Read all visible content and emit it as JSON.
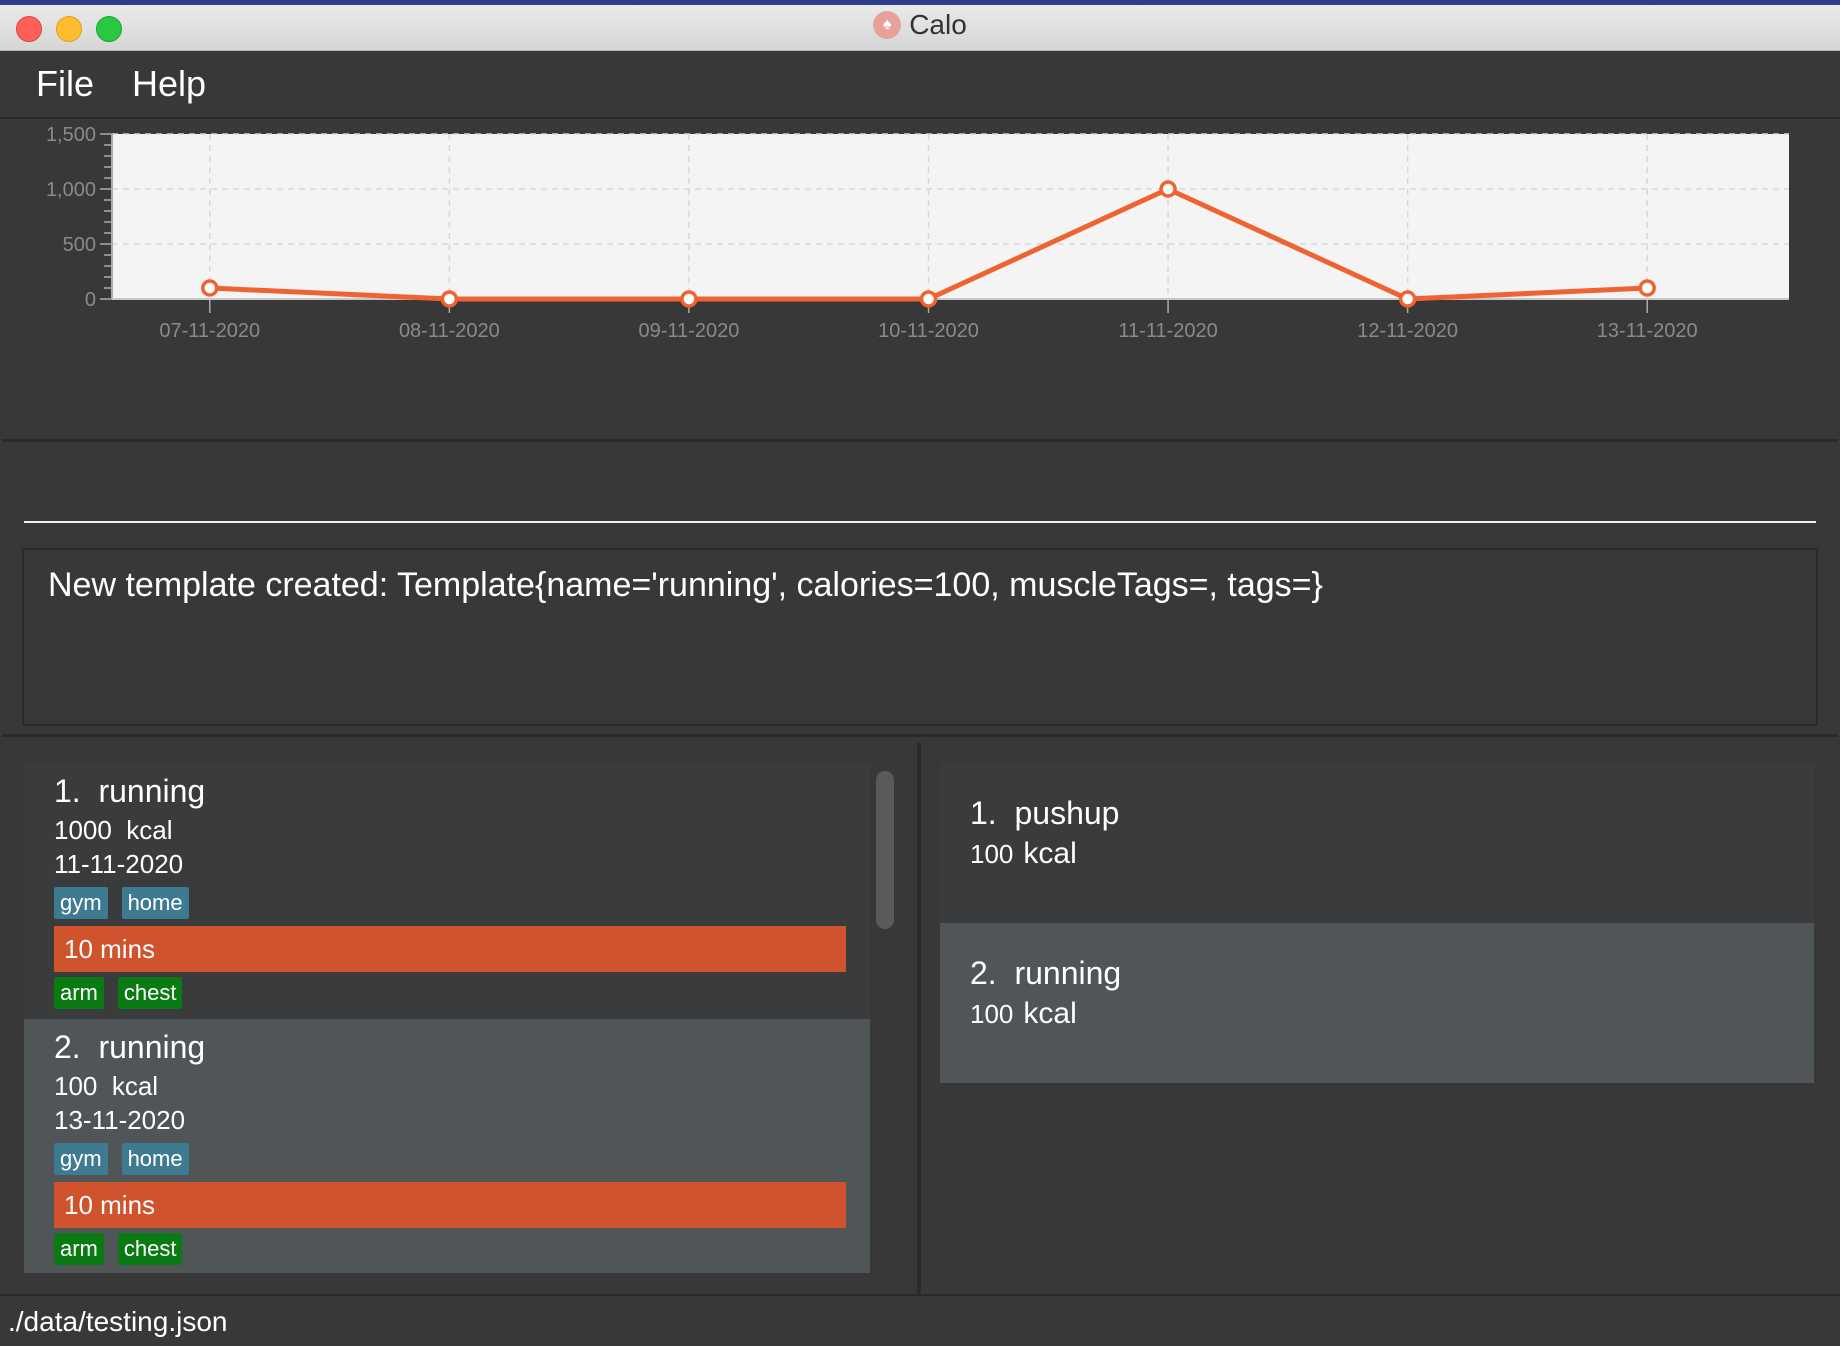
{
  "window": {
    "title": "Calo"
  },
  "menu": {
    "file": "File",
    "help": "Help"
  },
  "chart_data": {
    "type": "line",
    "x": [
      "07-11-2020",
      "08-11-2020",
      "09-11-2020",
      "10-11-2020",
      "11-11-2020",
      "12-11-2020",
      "13-11-2020"
    ],
    "series": [
      {
        "values": [
          100,
          0,
          0,
          0,
          1000,
          0,
          100
        ]
      }
    ],
    "y_ticks": [
      0,
      500,
      1000,
      1500
    ],
    "y_tick_labels": [
      "0",
      "500",
      "1,000",
      "1,500"
    ],
    "ylim": [
      0,
      1500
    ],
    "grid": true,
    "colors": {
      "line": "#ee6332",
      "plot_bg": "#f4f4f4"
    }
  },
  "command": {
    "value": ""
  },
  "result": {
    "text": "New template created: Template{name='running', calories=100, muscleTags=, tags=}"
  },
  "exercises": [
    {
      "index": "1.",
      "name": "running",
      "kcal_num": "1000",
      "kcal_unit": "kcal",
      "date": "11-11-2020",
      "tags": [
        "gym",
        "home"
      ],
      "duration": "10 mins",
      "muscles": [
        "arm",
        "chest"
      ]
    },
    {
      "index": "2.",
      "name": "running",
      "kcal_num": "100",
      "kcal_unit": "kcal",
      "date": "13-11-2020",
      "tags": [
        "gym",
        "home"
      ],
      "duration": "10 mins",
      "muscles": [
        "arm",
        "chest"
      ]
    }
  ],
  "templates": [
    {
      "index": "1.",
      "name": "pushup",
      "kcal_num": "100",
      "kcal_unit": "kcal"
    },
    {
      "index": "2.",
      "name": "running",
      "kcal_num": "100",
      "kcal_unit": "kcal"
    }
  ],
  "status": {
    "path": "./data/testing.json"
  }
}
